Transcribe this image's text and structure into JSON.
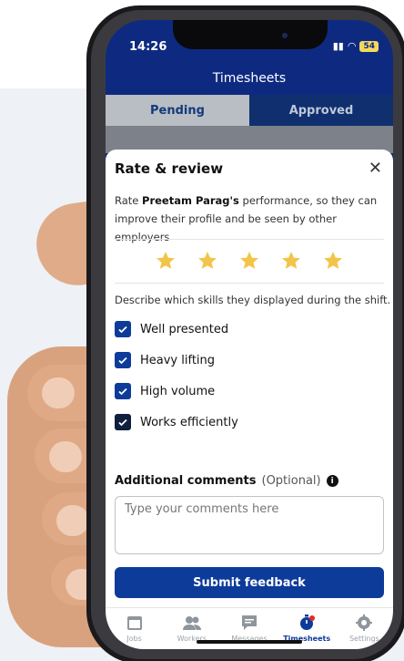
{
  "status": {
    "time": "14:26",
    "battery": "54"
  },
  "app": {
    "title": "Timesheets"
  },
  "tabs": [
    {
      "label": "Pending",
      "active": true
    },
    {
      "label": "Approved",
      "active": false
    }
  ],
  "dialog": {
    "title": "Rate & review",
    "description_prefix": "Rate ",
    "worker_name": "Preetam Parag's",
    "description_suffix": " performance, so they can improve their profile and be seen by other employers",
    "rating": 5,
    "rating_max": 5,
    "skills_prompt": "Describe which skills they displayed during the shift.",
    "skills": [
      {
        "label": "Well presented",
        "checked": true
      },
      {
        "label": "Heavy lifting",
        "checked": true
      },
      {
        "label": "High volume",
        "checked": true
      },
      {
        "label": "Works efficiently",
        "checked": true
      }
    ],
    "comments_label": "Additional comments",
    "comments_optional": "(Optional)",
    "comments_placeholder": "Type your comments here",
    "comments_value": "",
    "submit_label": "Submit feedback"
  },
  "nav": [
    {
      "label": "Jobs",
      "icon": "calendar-icon",
      "active": false
    },
    {
      "label": "Workers",
      "icon": "users-icon",
      "active": false
    },
    {
      "label": "Messages",
      "icon": "message-icon",
      "active": false
    },
    {
      "label": "Timesheets",
      "icon": "stopwatch-icon",
      "active": true
    },
    {
      "label": "Settings",
      "icon": "gear-icon",
      "active": false
    }
  ],
  "colors": {
    "primary": "#0d3b99",
    "star": "#f3c44a",
    "header": "#0e2a80"
  }
}
